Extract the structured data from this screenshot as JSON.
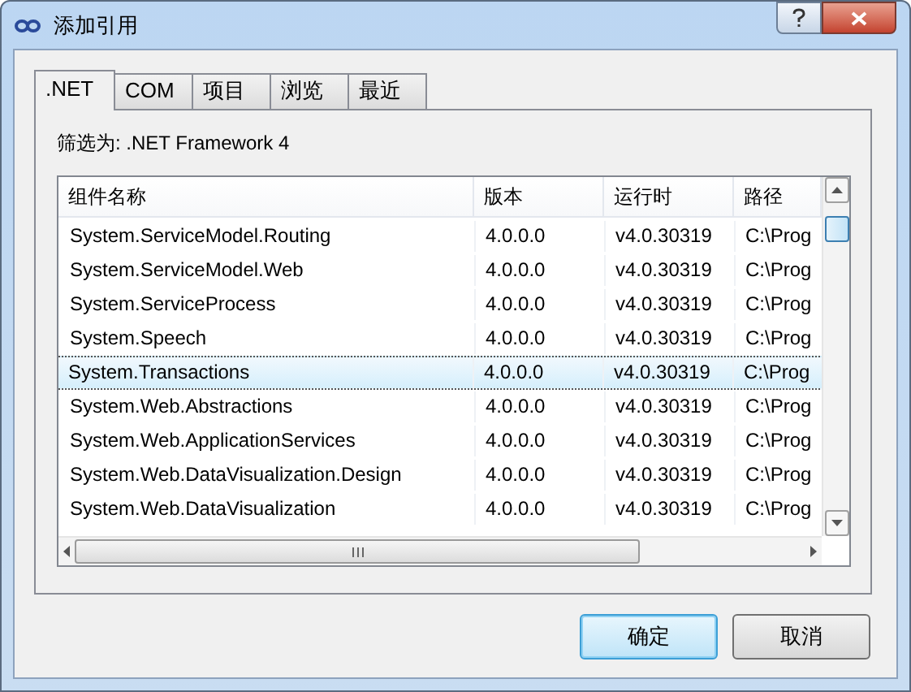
{
  "window": {
    "title": "添加引用"
  },
  "tabs": [
    {
      "label": ".NET",
      "selected": true
    },
    {
      "label": "COM",
      "selected": false
    },
    {
      "label": "项目",
      "selected": false
    },
    {
      "label": "浏览",
      "selected": false
    },
    {
      "label": "最近",
      "selected": false
    }
  ],
  "filter": "筛选为: .NET Framework 4",
  "table": {
    "columns": [
      "组件名称",
      "版本",
      "运行时",
      "路径"
    ],
    "rows": [
      {
        "cells": [
          "System.ServiceModel.Routing",
          "4.0.0.0",
          "v4.0.30319",
          "C:\\Prog"
        ],
        "selected": false
      },
      {
        "cells": [
          "System.ServiceModel.Web",
          "4.0.0.0",
          "v4.0.30319",
          "C:\\Prog"
        ],
        "selected": false
      },
      {
        "cells": [
          "System.ServiceProcess",
          "4.0.0.0",
          "v4.0.30319",
          "C:\\Prog"
        ],
        "selected": false
      },
      {
        "cells": [
          "System.Speech",
          "4.0.0.0",
          "v4.0.30319",
          "C:\\Prog"
        ],
        "selected": false
      },
      {
        "cells": [
          "System.Transactions",
          "4.0.0.0",
          "v4.0.30319",
          "C:\\Prog"
        ],
        "selected": true
      },
      {
        "cells": [
          "System.Web.Abstractions",
          "4.0.0.0",
          "v4.0.30319",
          "C:\\Prog"
        ],
        "selected": false
      },
      {
        "cells": [
          "System.Web.ApplicationServices",
          "4.0.0.0",
          "v4.0.30319",
          "C:\\Prog"
        ],
        "selected": false
      },
      {
        "cells": [
          "System.Web.DataVisualization.Design",
          "4.0.0.0",
          "v4.0.30319",
          "C:\\Prog"
        ],
        "selected": false
      },
      {
        "cells": [
          "System.Web.DataVisualization",
          "4.0.0.0",
          "v4.0.30319",
          "C:\\Prog"
        ],
        "selected": false
      }
    ]
  },
  "buttons": [
    {
      "label": "确定",
      "kind": "default"
    },
    {
      "label": "取消",
      "kind": "normal"
    }
  ]
}
